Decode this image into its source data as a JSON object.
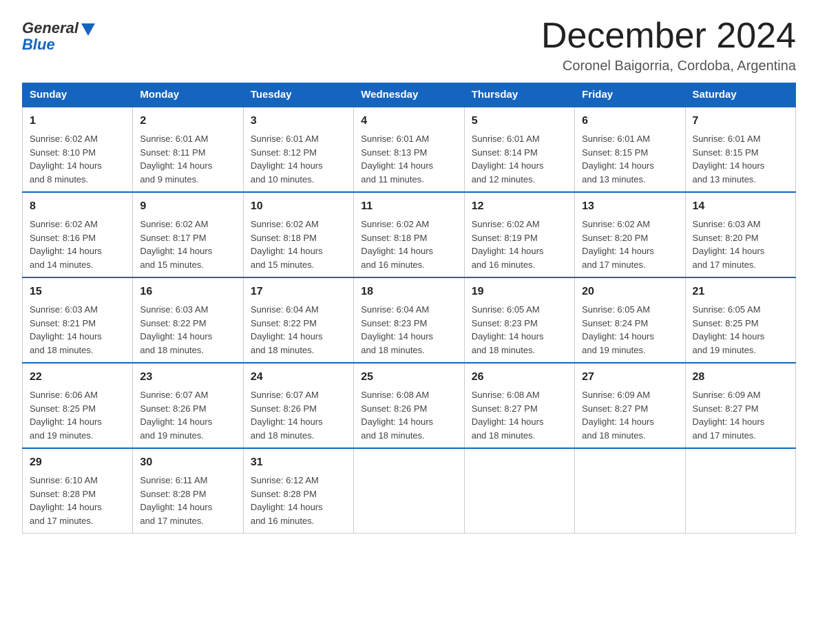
{
  "logo": {
    "general": "General",
    "blue": "Blue"
  },
  "title": "December 2024",
  "location": "Coronel Baigorria, Cordoba, Argentina",
  "days_of_week": [
    "Sunday",
    "Monday",
    "Tuesday",
    "Wednesday",
    "Thursday",
    "Friday",
    "Saturday"
  ],
  "weeks": [
    [
      {
        "day": "1",
        "sunrise": "6:02 AM",
        "sunset": "8:10 PM",
        "daylight": "14 hours and 8 minutes."
      },
      {
        "day": "2",
        "sunrise": "6:01 AM",
        "sunset": "8:11 PM",
        "daylight": "14 hours and 9 minutes."
      },
      {
        "day": "3",
        "sunrise": "6:01 AM",
        "sunset": "8:12 PM",
        "daylight": "14 hours and 10 minutes."
      },
      {
        "day": "4",
        "sunrise": "6:01 AM",
        "sunset": "8:13 PM",
        "daylight": "14 hours and 11 minutes."
      },
      {
        "day": "5",
        "sunrise": "6:01 AM",
        "sunset": "8:14 PM",
        "daylight": "14 hours and 12 minutes."
      },
      {
        "day": "6",
        "sunrise": "6:01 AM",
        "sunset": "8:15 PM",
        "daylight": "14 hours and 13 minutes."
      },
      {
        "day": "7",
        "sunrise": "6:01 AM",
        "sunset": "8:15 PM",
        "daylight": "14 hours and 13 minutes."
      }
    ],
    [
      {
        "day": "8",
        "sunrise": "6:02 AM",
        "sunset": "8:16 PM",
        "daylight": "14 hours and 14 minutes."
      },
      {
        "day": "9",
        "sunrise": "6:02 AM",
        "sunset": "8:17 PM",
        "daylight": "14 hours and 15 minutes."
      },
      {
        "day": "10",
        "sunrise": "6:02 AM",
        "sunset": "8:18 PM",
        "daylight": "14 hours and 15 minutes."
      },
      {
        "day": "11",
        "sunrise": "6:02 AM",
        "sunset": "8:18 PM",
        "daylight": "14 hours and 16 minutes."
      },
      {
        "day": "12",
        "sunrise": "6:02 AM",
        "sunset": "8:19 PM",
        "daylight": "14 hours and 16 minutes."
      },
      {
        "day": "13",
        "sunrise": "6:02 AM",
        "sunset": "8:20 PM",
        "daylight": "14 hours and 17 minutes."
      },
      {
        "day": "14",
        "sunrise": "6:03 AM",
        "sunset": "8:20 PM",
        "daylight": "14 hours and 17 minutes."
      }
    ],
    [
      {
        "day": "15",
        "sunrise": "6:03 AM",
        "sunset": "8:21 PM",
        "daylight": "14 hours and 18 minutes."
      },
      {
        "day": "16",
        "sunrise": "6:03 AM",
        "sunset": "8:22 PM",
        "daylight": "14 hours and 18 minutes."
      },
      {
        "day": "17",
        "sunrise": "6:04 AM",
        "sunset": "8:22 PM",
        "daylight": "14 hours and 18 minutes."
      },
      {
        "day": "18",
        "sunrise": "6:04 AM",
        "sunset": "8:23 PM",
        "daylight": "14 hours and 18 minutes."
      },
      {
        "day": "19",
        "sunrise": "6:05 AM",
        "sunset": "8:23 PM",
        "daylight": "14 hours and 18 minutes."
      },
      {
        "day": "20",
        "sunrise": "6:05 AM",
        "sunset": "8:24 PM",
        "daylight": "14 hours and 19 minutes."
      },
      {
        "day": "21",
        "sunrise": "6:05 AM",
        "sunset": "8:25 PM",
        "daylight": "14 hours and 19 minutes."
      }
    ],
    [
      {
        "day": "22",
        "sunrise": "6:06 AM",
        "sunset": "8:25 PM",
        "daylight": "14 hours and 19 minutes."
      },
      {
        "day": "23",
        "sunrise": "6:07 AM",
        "sunset": "8:26 PM",
        "daylight": "14 hours and 19 minutes."
      },
      {
        "day": "24",
        "sunrise": "6:07 AM",
        "sunset": "8:26 PM",
        "daylight": "14 hours and 18 minutes."
      },
      {
        "day": "25",
        "sunrise": "6:08 AM",
        "sunset": "8:26 PM",
        "daylight": "14 hours and 18 minutes."
      },
      {
        "day": "26",
        "sunrise": "6:08 AM",
        "sunset": "8:27 PM",
        "daylight": "14 hours and 18 minutes."
      },
      {
        "day": "27",
        "sunrise": "6:09 AM",
        "sunset": "8:27 PM",
        "daylight": "14 hours and 18 minutes."
      },
      {
        "day": "28",
        "sunrise": "6:09 AM",
        "sunset": "8:27 PM",
        "daylight": "14 hours and 17 minutes."
      }
    ],
    [
      {
        "day": "29",
        "sunrise": "6:10 AM",
        "sunset": "8:28 PM",
        "daylight": "14 hours and 17 minutes."
      },
      {
        "day": "30",
        "sunrise": "6:11 AM",
        "sunset": "8:28 PM",
        "daylight": "14 hours and 17 minutes."
      },
      {
        "day": "31",
        "sunrise": "6:12 AM",
        "sunset": "8:28 PM",
        "daylight": "14 hours and 16 minutes."
      },
      null,
      null,
      null,
      null
    ]
  ],
  "labels": {
    "sunrise": "Sunrise:",
    "sunset": "Sunset:",
    "daylight": "Daylight:"
  }
}
